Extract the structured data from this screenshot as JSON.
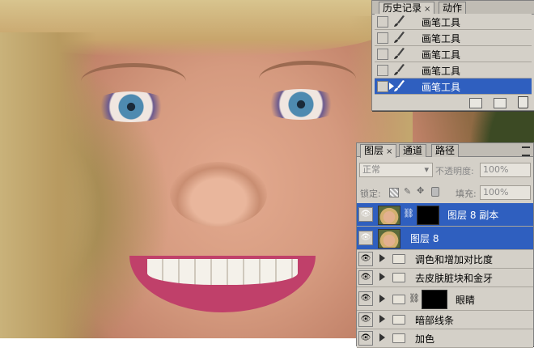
{
  "history_panel": {
    "tabs": [
      {
        "label": "历史记录",
        "close": "×"
      },
      {
        "label": "动作"
      }
    ],
    "items": [
      {
        "label": "画笔工具"
      },
      {
        "label": "画笔工具"
      },
      {
        "label": "画笔工具"
      },
      {
        "label": "画笔工具"
      },
      {
        "label": "画笔工具",
        "selected": true
      }
    ]
  },
  "layers_panel": {
    "tabs": [
      {
        "label": "图层",
        "close": "×"
      },
      {
        "label": "通道"
      },
      {
        "label": "路径"
      }
    ],
    "blend_mode": "正常",
    "opacity_label": "不透明度:",
    "opacity_value": "100%",
    "lock_label": "锁定:",
    "fill_label": "填充:",
    "fill_value": "100%",
    "layers": [
      {
        "name": "图层 8 副本",
        "type": "layer",
        "selected": true
      },
      {
        "name": "图层 8",
        "type": "layer",
        "selected": true
      },
      {
        "name": "调色和增加对比度",
        "type": "group"
      },
      {
        "name": "去皮肤脏块和金牙",
        "type": "group"
      },
      {
        "name": "眼睛",
        "type": "group"
      },
      {
        "name": "暗部线条",
        "type": "group"
      },
      {
        "name": "加色",
        "type": "group"
      }
    ]
  },
  "colors": {
    "selection": "#2f5fbf",
    "panel_bg": "#d4d0c8"
  }
}
